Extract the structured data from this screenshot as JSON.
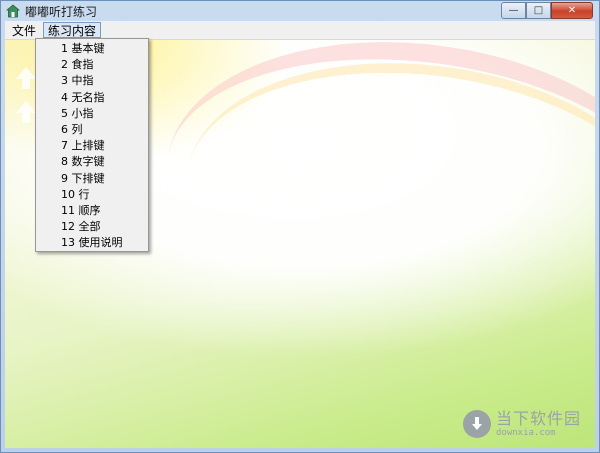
{
  "window": {
    "title": "嘟嘟听打练习",
    "controls": {
      "minimize": "—",
      "maximize": "□",
      "close": "✕"
    }
  },
  "menubar": {
    "items": [
      {
        "label": "文件"
      },
      {
        "label": "练习内容",
        "active": true
      }
    ]
  },
  "dropdown": {
    "items": [
      {
        "label": "1  基本键"
      },
      {
        "label": "2  食指"
      },
      {
        "label": "3  中指"
      },
      {
        "label": "4  无名指"
      },
      {
        "label": "5  小指"
      },
      {
        "label": "6  列"
      },
      {
        "label": "7  上排键"
      },
      {
        "label": "8  数字键"
      },
      {
        "label": "9  下排键"
      },
      {
        "label": "10 行"
      },
      {
        "label": "11 顺序"
      },
      {
        "label": "12 全部"
      },
      {
        "label": "13 使用说明"
      }
    ]
  },
  "watermark": {
    "name": "当下软件园",
    "domain": "downxia.com",
    "icon": "download-arrow-icon"
  },
  "colors": {
    "titlebar": "#c9dbef",
    "menu_active": "#dce7f5",
    "close_button": "#c8412b",
    "background_green": "#c9eb8a"
  }
}
